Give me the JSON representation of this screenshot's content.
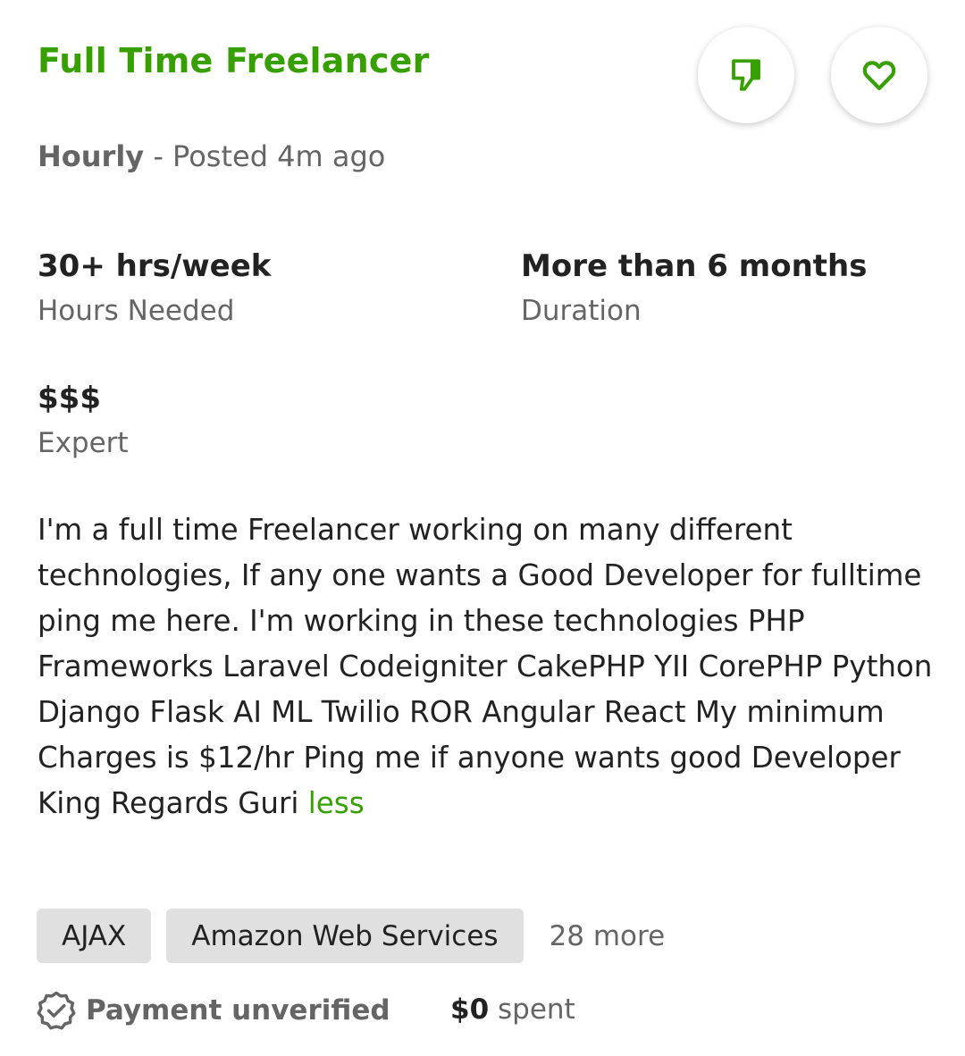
{
  "job": {
    "title": "Full Time Freelancer",
    "job_type": "Hourly",
    "posted": "- Posted 4m ago",
    "hours_value": "30+ hrs/week",
    "hours_label": "Hours Needed",
    "duration_value": "More than 6 months",
    "duration_label": "Duration",
    "tier_value": "$$$",
    "tier_label": "Expert",
    "description": "I'm a full time Freelancer working on many different technologies, If any one wants a Good Developer for fulltime ping me here. I'm working in these technologies PHP Frameworks Laravel Codeigniter CakePHP YII CorePHP Python Django Flask AI ML Twilio ROR Angular React My minimum Charges is $12/hr Ping me if anyone wants good Developer King Regards Guri",
    "less_label": "less"
  },
  "actions": {
    "dislike_icon": "thumbs-down-icon",
    "save_icon": "heart-icon"
  },
  "skills": {
    "items": [
      "AJAX",
      "Amazon Web Services"
    ],
    "more_label": "28 more"
  },
  "client": {
    "payment_status": "Payment unverified",
    "payment_icon": "verified-badge-icon",
    "spent_amount": "$0",
    "spent_label": "spent"
  },
  "colors": {
    "accent": "#37a000",
    "text_primary": "#222222",
    "text_secondary": "#656565",
    "chip_background": "#e0e0e0"
  }
}
